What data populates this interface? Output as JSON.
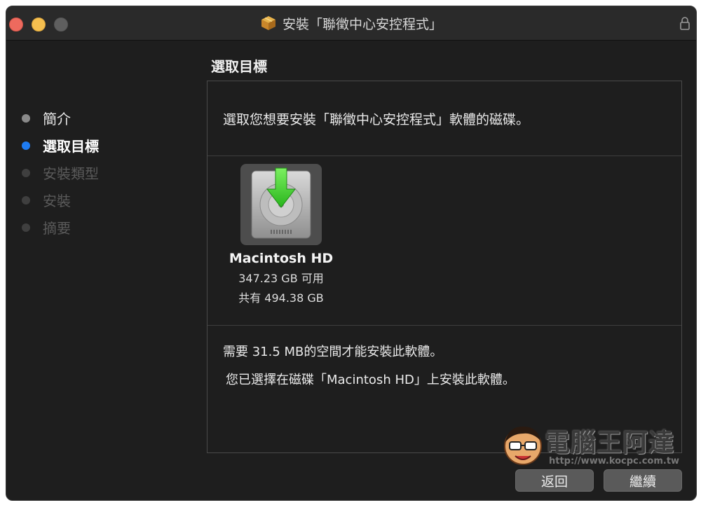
{
  "window": {
    "title": "安裝「聯徵中心安控程式」",
    "icon": "package-icon",
    "lock_icon": "lock-icon"
  },
  "section_title": "選取目標",
  "steps": [
    {
      "label": "簡介",
      "state": "done"
    },
    {
      "label": "選取目標",
      "state": "active"
    },
    {
      "label": "安裝類型",
      "state": "todo"
    },
    {
      "label": "安裝",
      "state": "todo"
    },
    {
      "label": "摘要",
      "state": "todo"
    }
  ],
  "panel": {
    "prompt": "選取您想要安裝「聯徵中心安控程式」軟體的磁碟。",
    "disk": {
      "name": "Macintosh HD",
      "free": "347.23 GB 可用",
      "total": "共有 494.38 GB",
      "icon": "hard-drive-install-icon"
    },
    "requirement": "需要 31.5 MB的空間才能安裝此軟體。",
    "selection": "您已選擇在磁碟「Macintosh HD」上安裝此軟體。"
  },
  "watermark": {
    "text": "電腦王阿達",
    "url": "http://www.kocpc.com.tw"
  },
  "buttons": {
    "back": "返回",
    "continue": "繼續"
  },
  "colors": {
    "accent": "#1e7cf2",
    "close": "#ed6a5e",
    "minimize": "#f5bf4f",
    "arrow": "#3ecf2e"
  }
}
